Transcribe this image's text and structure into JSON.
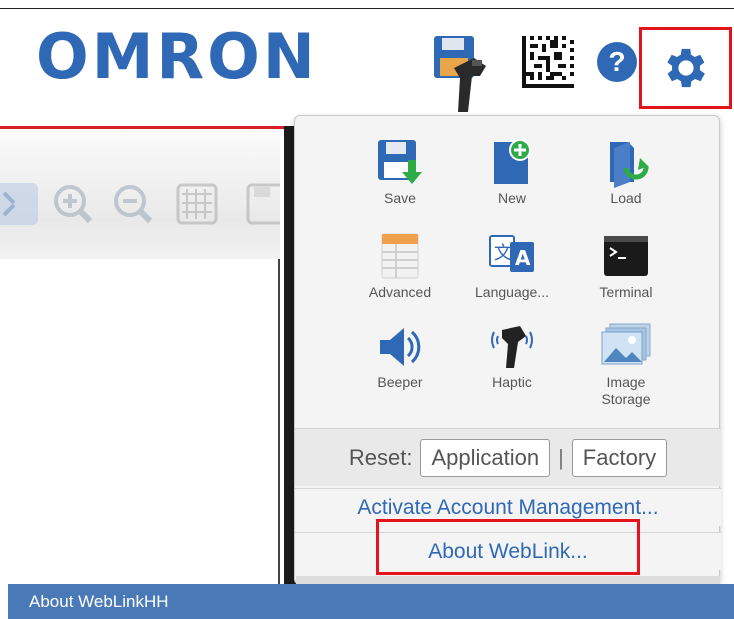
{
  "header": {
    "logo_text": "OMRON",
    "help_glyph": "?",
    "icons": [
      "save-scanner-icon",
      "datamatrix-icon",
      "help-icon",
      "gear-icon"
    ],
    "brand_color": "#2f69b5",
    "highlight_color": "#e3141d"
  },
  "menu": {
    "items": [
      {
        "label": "Save",
        "icon": "save-icon"
      },
      {
        "label": "New",
        "icon": "new-file-icon"
      },
      {
        "label": "Load",
        "icon": "load-icon"
      },
      {
        "label": "Advanced",
        "icon": "advanced-table-icon"
      },
      {
        "label": "Language...",
        "icon": "language-icon"
      },
      {
        "label": "Terminal",
        "icon": "terminal-icon"
      },
      {
        "label": "Beeper",
        "icon": "speaker-icon"
      },
      {
        "label": "Haptic",
        "icon": "haptic-scanner-icon"
      },
      {
        "label_line1": "Image",
        "label_line2": "Storage",
        "icon": "image-storage-icon"
      }
    ],
    "reset_label": "Reset:",
    "reset_application": "Application",
    "reset_separator": "|",
    "reset_factory": "Factory",
    "activate_link": "Activate Account Management...",
    "about_link": "About WebLink..."
  },
  "status_bar": {
    "text": "About WebLinkHH"
  }
}
